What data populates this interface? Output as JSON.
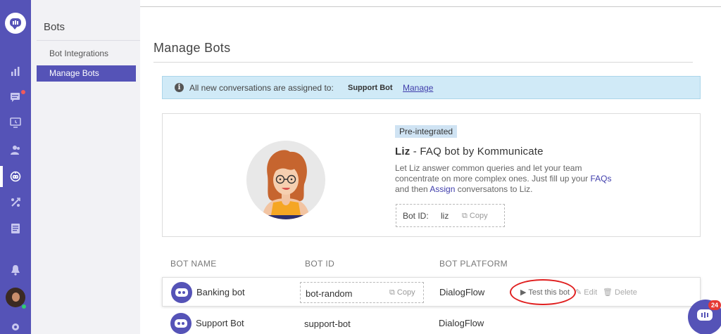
{
  "subnav": {
    "title": "Bots",
    "items": [
      {
        "label": "Bot Integrations"
      },
      {
        "label": "Manage Bots"
      }
    ]
  },
  "page": {
    "title": "Manage Bots"
  },
  "banner": {
    "message": "All new conversations are assigned to:",
    "bot": "Support Bot",
    "manage": "Manage"
  },
  "featured": {
    "tag": "Pre-integrated",
    "name": "Liz",
    "subtitle": " - FAQ bot by Kommunicate",
    "desc_pre": "Let Liz answer common queries and let your team concentrate on more complex ones. Just fill up your ",
    "desc_link1": "FAQs",
    "desc_mid": " and then ",
    "desc_link2": "Assign",
    "desc_post": " conversatons to Liz.",
    "id_label": "Bot ID:",
    "id_value": "liz",
    "copy": "Copy"
  },
  "table": {
    "headers": [
      "BOT NAME",
      "BOT ID",
      "BOT PLATFORM"
    ],
    "rows": [
      {
        "name": "Banking bot",
        "id": "bot-random",
        "copy": "Copy",
        "platform": "DialogFlow",
        "test": "Test this bot",
        "edit": "Edit",
        "delete": "Delete"
      },
      {
        "name": "Support Bot",
        "id": "support-bot",
        "platform": "DialogFlow"
      }
    ]
  },
  "launcher": {
    "badge": "24"
  },
  "colors": {
    "brand": "#5553b7",
    "banner": "#d0eaf7",
    "highlight": "#e02020"
  },
  "icons": [
    "analytics-icon",
    "conversations-icon",
    "reports-icon",
    "users-icon",
    "bot-icon",
    "integrations-icon",
    "docs-icon",
    "bell-icon",
    "settings-icon"
  ]
}
